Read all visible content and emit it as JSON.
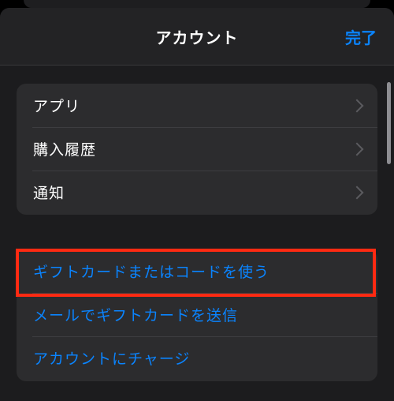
{
  "nav": {
    "title": "アカウント",
    "done_label": "完了"
  },
  "groups": [
    {
      "items": [
        {
          "label": "アプリ"
        },
        {
          "label": "購入履歴"
        },
        {
          "label": "通知"
        }
      ]
    },
    {
      "items": [
        {
          "label": "ギフトカードまたはコードを使う"
        },
        {
          "label": "メールでギフトカードを送信"
        },
        {
          "label": "アカウントにチャージ"
        }
      ]
    }
  ],
  "colors": {
    "accent": "#0a84ff",
    "highlight": "#ff2a12",
    "background": "#1c1c1e",
    "cell": "#2c2c2e"
  },
  "icons": {
    "row_chevron": "chevron-right-icon"
  }
}
